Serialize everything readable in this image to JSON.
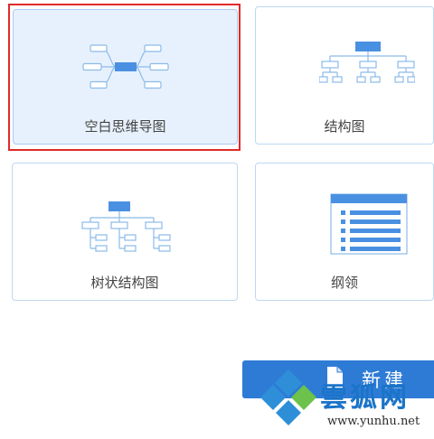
{
  "templates": [
    {
      "label": "空白思维导图",
      "selected": true
    },
    {
      "label": "结构图",
      "selected": false
    },
    {
      "label": "树状结构图",
      "selected": false
    },
    {
      "label": "纲领",
      "selected": false
    }
  ],
  "new_button": {
    "label": "新建"
  },
  "watermark": {
    "title": "雲狐网",
    "url": "www.yunhu.net"
  },
  "colors": {
    "card_border": "#bcd8f2",
    "card_selected_bg": "#e7f1fd",
    "diagram_line": "#8bbbe8",
    "diagram_accent": "#4a90e2",
    "selection_outline": "#e02a2a",
    "button_bg": "#2e7bd6"
  }
}
